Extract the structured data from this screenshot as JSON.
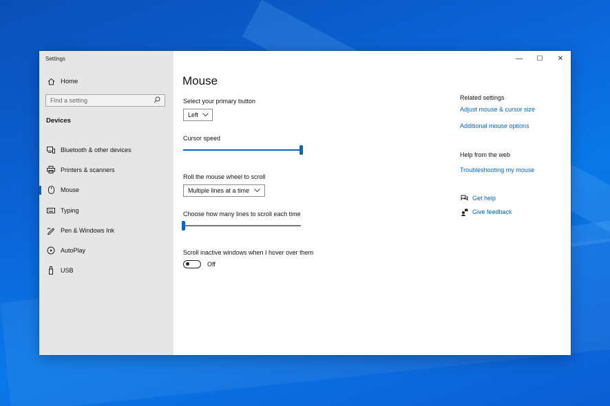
{
  "window": {
    "app_title": "Settings",
    "minimize": "—",
    "maximize": "☐",
    "close": "✕"
  },
  "sidebar": {
    "home": "Home",
    "search_placeholder": "Find a setting",
    "section": "Devices",
    "items": [
      {
        "label": "Bluetooth & other devices",
        "icon": "bluetooth-devices-icon"
      },
      {
        "label": "Printers & scanners",
        "icon": "printer-icon"
      },
      {
        "label": "Mouse",
        "icon": "mouse-icon",
        "active": true
      },
      {
        "label": "Typing",
        "icon": "keyboard-icon"
      },
      {
        "label": "Pen & Windows Ink",
        "icon": "pen-icon"
      },
      {
        "label": "AutoPlay",
        "icon": "autoplay-icon"
      },
      {
        "label": "USB",
        "icon": "usb-icon"
      }
    ]
  },
  "main": {
    "title": "Mouse",
    "primary_button_label": "Select your primary button",
    "primary_button_value": "Left",
    "cursor_speed_label": "Cursor speed",
    "cursor_speed_fraction": 1.0,
    "scroll_label": "Roll the mouse wheel to scroll",
    "scroll_value": "Multiple lines at a time",
    "lines_label": "Choose how many lines to scroll each time",
    "lines_fraction": 0.0,
    "inactive_label": "Scroll inactive windows when I hover over them",
    "inactive_state": "Off"
  },
  "related": {
    "heading": "Related settings",
    "link1": "Adjust mouse & cursor size",
    "link2": "Additional mouse options",
    "help_heading": "Help from the web",
    "help_link": "Troubleshooting my mouse",
    "get_help": "Get help",
    "give_feedback": "Give feedback"
  },
  "colors": {
    "accent": "#0067c0",
    "sidebar_bg": "#e6e6e6"
  }
}
